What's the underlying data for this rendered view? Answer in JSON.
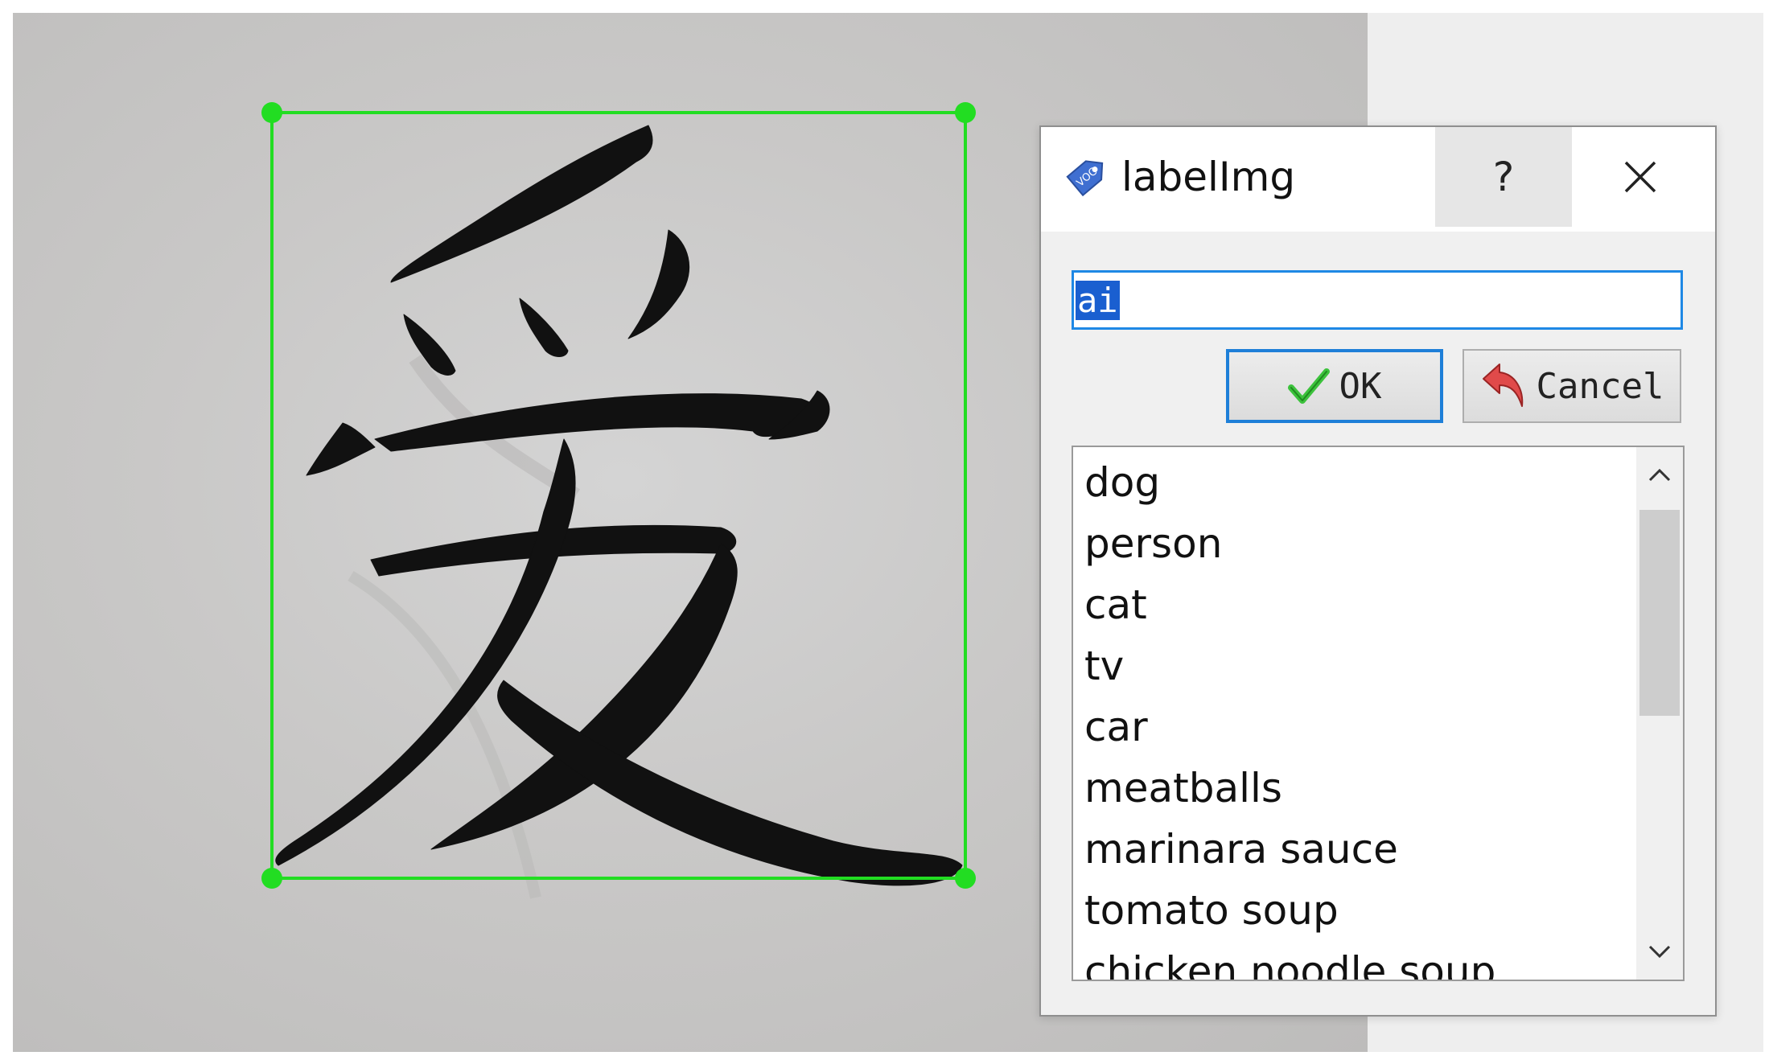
{
  "dialog": {
    "title": "labelImg",
    "app_icon_text": "VOC",
    "help_label": "?",
    "input_value": "ai",
    "ok_label": "OK",
    "cancel_label": "Cancel",
    "labels": [
      "dog",
      "person",
      "cat",
      "tv",
      "car",
      "meatballs",
      "marinara sauce",
      "tomato soup",
      "chicken noodle soup"
    ]
  },
  "icons": {
    "app": "voc-tag-icon",
    "help": "question-icon",
    "close": "close-icon",
    "ok": "checkmark-icon",
    "cancel": "undo-arrow-icon",
    "scroll_up": "chevron-up-icon",
    "scroll_down": "chevron-down-icon"
  },
  "colors": {
    "bbox": "#22dd22",
    "input_border": "#1e88e5",
    "selection": "#1a5fd0",
    "ok_border": "#1e7fd8",
    "check": "#3cc23c",
    "cancel_arrow": "#e04a4a"
  }
}
